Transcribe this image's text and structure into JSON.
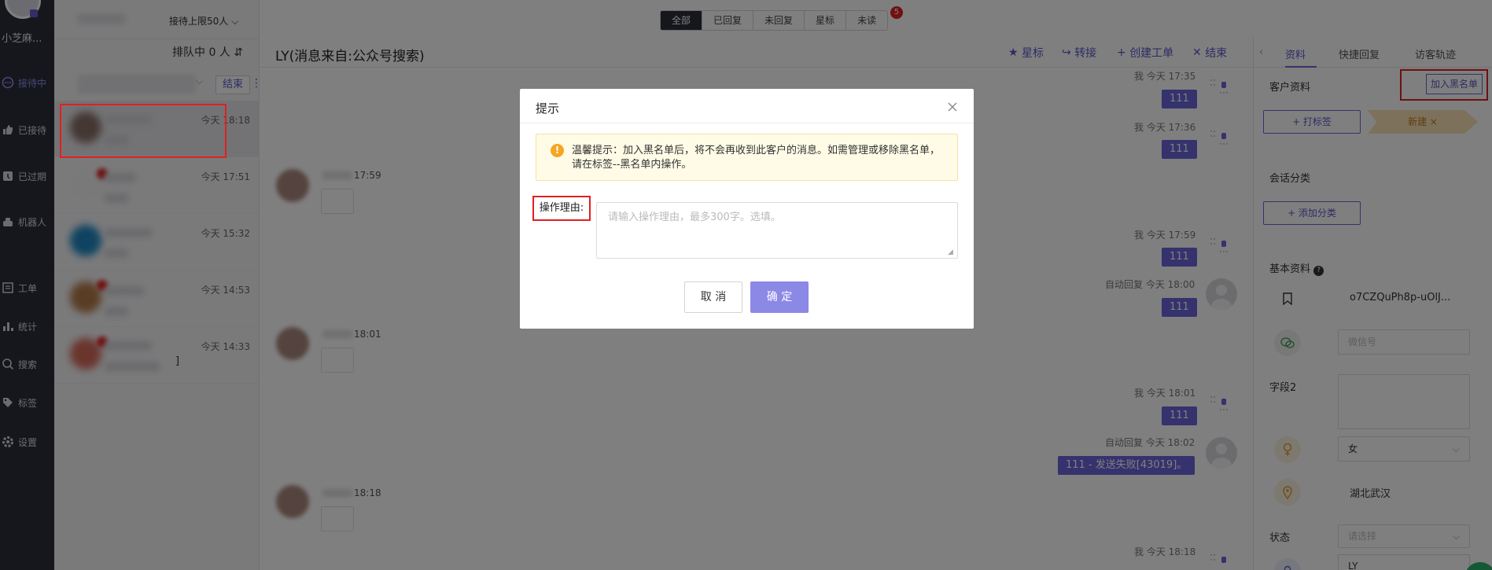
{
  "nav": {
    "username": "小芝麻...",
    "items": [
      {
        "label": "接待中",
        "icon": "chat-icon",
        "active": true
      },
      {
        "label": "已接待",
        "icon": "thumb-icon"
      },
      {
        "label": "已过期",
        "icon": "expired-icon"
      },
      {
        "label": "机器人",
        "icon": "robot-icon"
      },
      {
        "label": "工单",
        "icon": "ticket-icon"
      },
      {
        "label": "统计",
        "icon": "stats-icon"
      },
      {
        "label": "搜索",
        "icon": "search-icon"
      },
      {
        "label": "标签",
        "icon": "tag-icon"
      },
      {
        "label": "设置",
        "icon": "settings-icon"
      }
    ]
  },
  "list": {
    "reception_limit": "接待上限50人",
    "queue": "排队中 0 人",
    "end_label": "结束",
    "conversations": [
      {
        "time": "今天 18:18"
      },
      {
        "time": "今天 17:51"
      },
      {
        "time": "今天 15:32"
      },
      {
        "time": "今天 14:53"
      },
      {
        "time": "今天 14:33"
      }
    ],
    "partial_bracket": "]"
  },
  "filter_tabs": [
    "全部",
    "已回复",
    "未回复",
    "星标",
    "未读"
  ],
  "unread_badge": "5",
  "chat": {
    "title": "LY(消息来自:公众号搜索)",
    "actions": {
      "star": "星标",
      "transfer": "转接",
      "create_ticket": "创建工单",
      "end": "结束"
    },
    "outgoing": [
      {
        "meta": "我  今天 17:35",
        "text": "111"
      },
      {
        "meta": "我  今天 17:36",
        "text": "111"
      },
      {
        "meta": "我  今天 17:59",
        "text": "111"
      },
      {
        "meta": "自动回复  今天 18:00",
        "text": "111"
      },
      {
        "meta": "我  今天 18:01",
        "text": "111"
      },
      {
        "meta": "自动回复  今天 18:02",
        "text": "111 - 发送失败[43019]。"
      },
      {
        "meta": "我  今天 18:18",
        "text": ""
      }
    ],
    "incoming_times": [
      "17:59",
      "18:01",
      "18:18"
    ]
  },
  "right_panel": {
    "tabs": [
      "资料",
      "快捷回复",
      "访客轨迹"
    ],
    "customer_info": "客户资料",
    "blacklist_button": "加入黑名单",
    "tag_button": "+ 打标签",
    "new_tag": "新建 ×",
    "session_category": "会话分类",
    "add_category_button": "+ 添加分类",
    "basic_info": "基本资料",
    "openid": "o7CZQuPh8p-uOlJ...",
    "wechat_placeholder": "微信号",
    "field2": "字段2",
    "gender": "女",
    "location": "湖北武汉",
    "status_label": "状态",
    "status_placeholder": "请选择",
    "name_value": "LY"
  },
  "modal": {
    "title": "提示",
    "tip": "温馨提示：加入黑名单后，将不会再收到此客户的消息。如需管理或移除黑名单，请在标签--黑名单内操作。",
    "reason_label": "操作理由:",
    "reason_placeholder": "请输入操作理由，最多300字。选填。",
    "cancel": "取 消",
    "confirm": "确 定"
  },
  "colors": {
    "accent": "#6b65dd",
    "nav_bg": "#2c2f3b",
    "highlight": "#e02020",
    "confirm": "#8c88e6"
  }
}
